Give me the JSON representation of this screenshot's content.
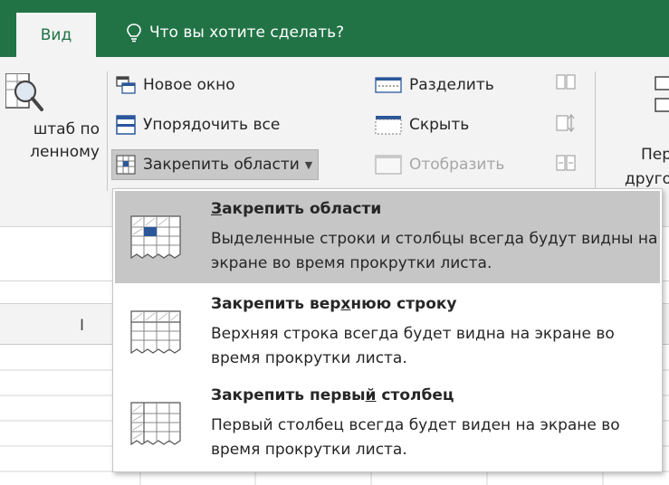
{
  "ribbon_tabs": {
    "active_tab": "Вид",
    "tell_me": "Что вы хотите сделать?"
  },
  "zoom_group": {
    "label": "штаб по\nленному"
  },
  "window_group": {
    "new_window": "Новое окно",
    "arrange_all": "Упорядочить все",
    "freeze_panes": "Закрепить области",
    "split": "Разделить",
    "hide": "Скрыть",
    "unhide": "Отобразить"
  },
  "right_button": {
    "label": "Пер\nдруго"
  },
  "grid": {
    "column_label": "I"
  },
  "freeze_menu": {
    "items": [
      {
        "title_pre": "",
        "title_u": "З",
        "title_post": "акрепить области",
        "description": "Выделенные строки и столбцы всегда будут видны на экране во время прокрутки листа."
      },
      {
        "title_pre": "Закрепить вер",
        "title_u": "х",
        "title_post": "нюю строку",
        "description": "Верхняя строка всегда будет видна на экране во время прокрутки листа."
      },
      {
        "title_pre": "Закрепить первы",
        "title_u": "й",
        "title_post": " столбец",
        "description": "Первый столбец всегда будет виден на экране во время прокрутки листа."
      }
    ]
  },
  "colors": {
    "ribbon_green": "#217346",
    "ribbon_bg": "#f3f3f3",
    "highlight": "#c6c6c6",
    "icon_blue": "#2b579a"
  }
}
